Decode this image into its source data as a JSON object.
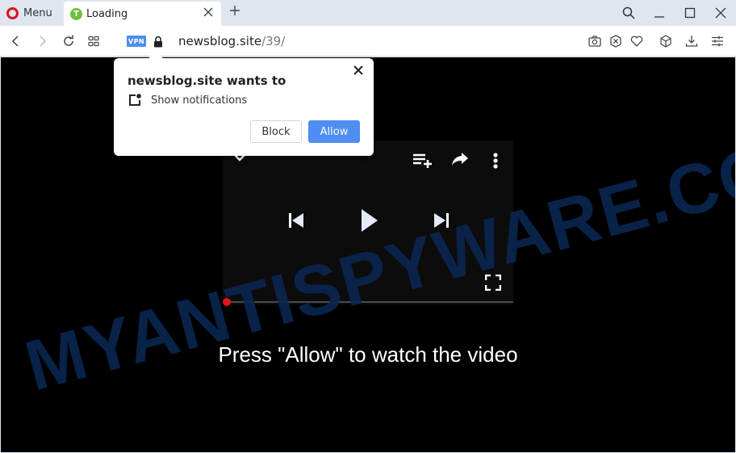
{
  "browser": {
    "menu_label": "Menu",
    "tab": {
      "title": "Loading",
      "favicon_letter": "T",
      "favicon_color": "#6fbe3a"
    },
    "new_tab_icon": "plus-icon",
    "window_controls": [
      "search-icon",
      "minimize-icon",
      "maximize-icon",
      "close-icon"
    ],
    "nav": [
      "back-icon",
      "forward-icon",
      "reload-icon",
      "tabs-grid-icon"
    ],
    "vpn_label": "VPN",
    "address": {
      "domain": "newsblog.site",
      "path": "/39/"
    },
    "toolbar_right": [
      "camera-icon",
      "adblock-icon",
      "heart-icon",
      "cube-icon",
      "download-icon",
      "settings-sliders-icon"
    ],
    "accent_color": "#4d8ef0"
  },
  "popup": {
    "title": "newsblog.site wants to",
    "permission": "Show notifications",
    "block_label": "Block",
    "allow_label": "Allow"
  },
  "page": {
    "watermark": "MYANTISPYWARE.COM",
    "cta": "Press \"Allow\" to watch the video",
    "player": {
      "progress": 0,
      "icons": [
        "chevron-down-icon",
        "playlist-add-icon",
        "share-icon",
        "more-vert-icon",
        "skip-previous-icon",
        "play-icon",
        "skip-next-icon",
        "fullscreen-icon"
      ]
    }
  }
}
